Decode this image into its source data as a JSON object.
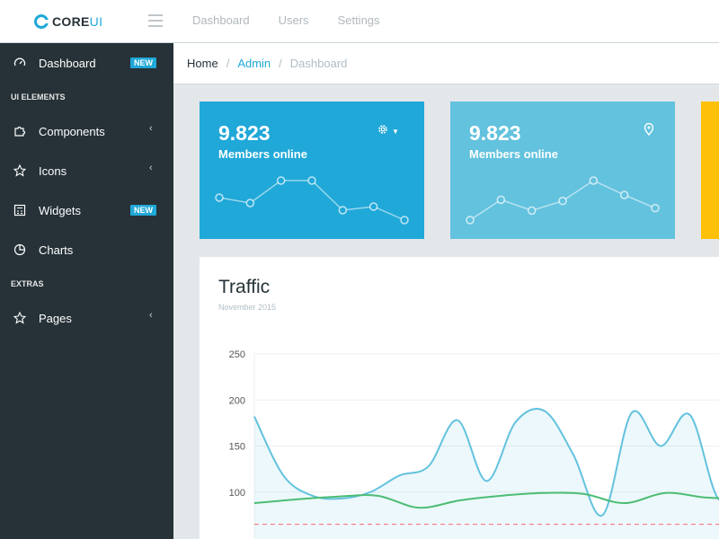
{
  "header": {
    "brand_main": "CORE",
    "brand_accent": "UI",
    "nav": [
      "Dashboard",
      "Users",
      "Settings"
    ]
  },
  "sidebar": {
    "dashboard": {
      "label": "Dashboard",
      "badge": "NEW"
    },
    "section_ui": "UI ELEMENTS",
    "components": "Components",
    "icons": "Icons",
    "widgets": {
      "label": "Widgets",
      "badge": "NEW"
    },
    "charts": "Charts",
    "section_extras": "EXTRAS",
    "pages": "Pages"
  },
  "breadcrumb": {
    "home": "Home",
    "admin": "Admin",
    "current": "Dashboard"
  },
  "cards": [
    {
      "value": "9.823",
      "label": "Members online",
      "color": "#20a8d8",
      "control": "gear-dropdown"
    },
    {
      "value": "9.823",
      "label": "Members online",
      "color": "#63c2de",
      "control": "location-pin"
    },
    {
      "color": "#ffc107"
    }
  ],
  "sparklines": [
    [
      65,
      59,
      84,
      84,
      51,
      55,
      40
    ],
    [
      1,
      18,
      9,
      17,
      34,
      22,
      11
    ]
  ],
  "traffic": {
    "title": "Traffic",
    "subtitle": "November 2015",
    "chart_data": {
      "type": "line",
      "ylim": [
        50,
        250
      ],
      "yticks": [
        250,
        200,
        150,
        100
      ],
      "grid": true,
      "series": [
        {
          "values": [
            182,
            118,
            96,
            93,
            100,
            118,
            128,
            178,
            112,
            176,
            188,
            140,
            75,
            186,
            150,
            184,
            92,
            110
          ]
        },
        {
          "values": [
            88,
            92,
            95,
            96,
            83,
            91,
            96,
            99,
            98,
            88,
            99,
            94,
            93
          ]
        },
        {
          "values": [
            65,
            65,
            65,
            65,
            65,
            65,
            65,
            65,
            65,
            65,
            65,
            65,
            65
          ]
        }
      ],
      "colors": [
        "#63c2de",
        "#4dbd74",
        "#f86c6b"
      ]
    }
  }
}
